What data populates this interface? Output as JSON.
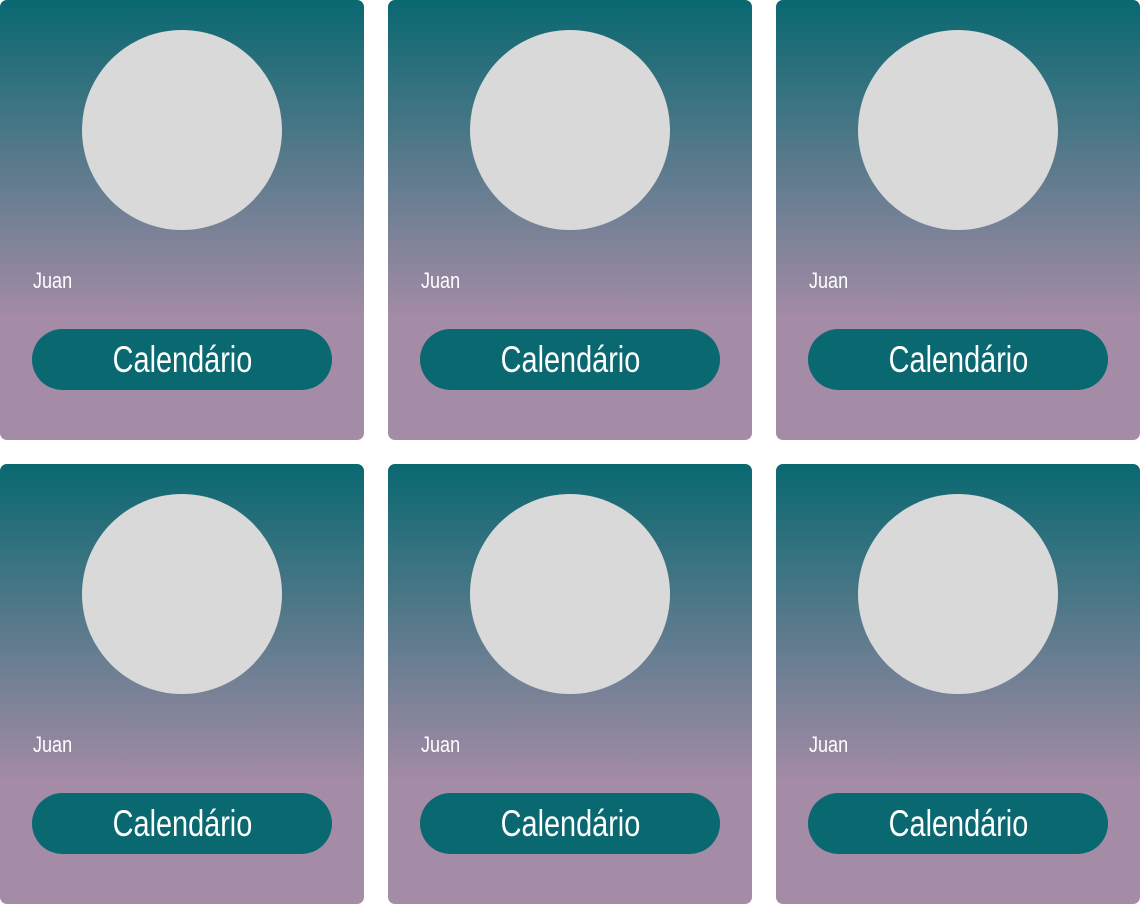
{
  "cards": [
    {
      "name": "Juan",
      "button_label": "Calendário"
    },
    {
      "name": "Juan",
      "button_label": "Calendário"
    },
    {
      "name": "Juan",
      "button_label": "Calendário"
    },
    {
      "name": "Juan",
      "button_label": "Calendário"
    },
    {
      "name": "Juan",
      "button_label": "Calendário"
    },
    {
      "name": "Juan",
      "button_label": "Calendário"
    }
  ],
  "colors": {
    "card_gradient_top": "#096870",
    "card_gradient_bottom": "#a48ba6",
    "button_background": "#096870",
    "avatar_placeholder": "#d9d9d9",
    "text": "#ffffff"
  }
}
